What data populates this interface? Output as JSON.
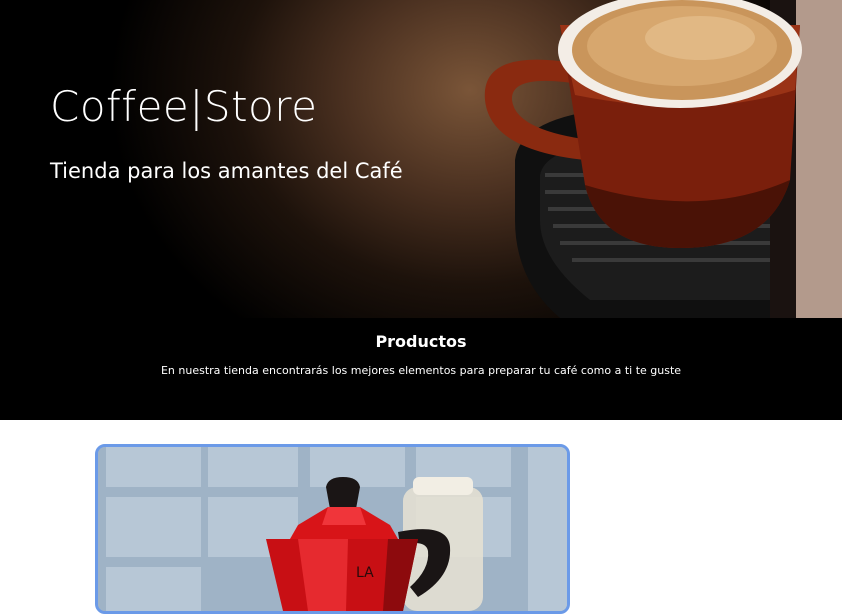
{
  "hero": {
    "title": "Coffee|Store",
    "subtitle": "Tienda para los amantes del Café",
    "image": "coffee-cup-espresso-machine-photo"
  },
  "products": {
    "title": "Productos",
    "description": "En nuestra tienda encontrarás los mejores elementos para preparar tu café como a ti te guste"
  },
  "product_card": {
    "image": "red-moka-pot-photo",
    "border_color": "#6b9ae8"
  },
  "colors": {
    "background": "#ffffff",
    "band": "#000000",
    "text_on_dark": "#ffffff"
  }
}
